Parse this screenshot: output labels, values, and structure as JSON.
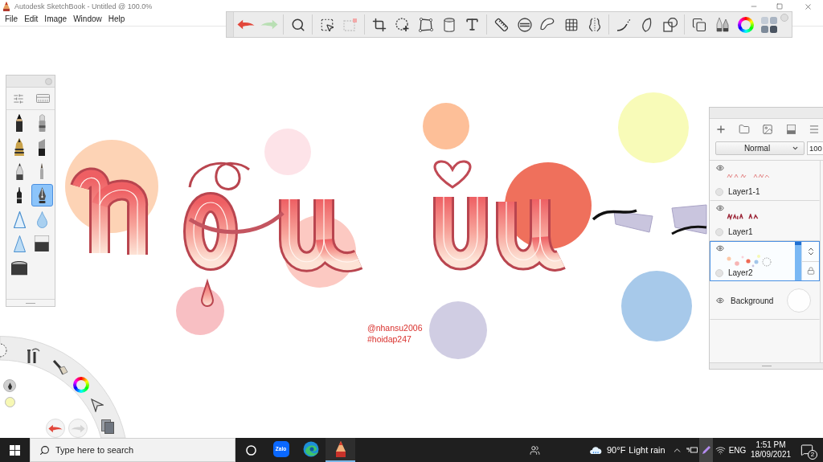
{
  "window": {
    "title": "Autodesk SketchBook - Untitled @ 100.0%"
  },
  "menu": [
    "File",
    "Edit",
    "Image",
    "Window",
    "Help"
  ],
  "toolbar": {
    "undo": {
      "disabled": false
    },
    "redo": {
      "disabled": true
    }
  },
  "brush_palette": {
    "brushes": [
      {
        "kind": "pencil",
        "selected": false
      },
      {
        "kind": "airbrush",
        "selected": false
      },
      {
        "kind": "inker",
        "selected": false
      },
      {
        "kind": "chisel",
        "selected": false
      },
      {
        "kind": "ballpoint",
        "selected": false
      },
      {
        "kind": "paintbrush",
        "selected": false
      },
      {
        "kind": "technical-pen",
        "selected": false
      },
      {
        "kind": "fountain-pen",
        "selected": true
      },
      {
        "kind": "smudge",
        "selected": false
      },
      {
        "kind": "drop",
        "selected": false
      },
      {
        "kind": "sharpen",
        "selected": false
      },
      {
        "kind": "hard-eraser",
        "selected": false
      },
      {
        "kind": "soft-eraser",
        "selected": false
      }
    ]
  },
  "layers_panel": {
    "blend_mode": "Normal",
    "opacity": "100",
    "layers": [
      {
        "kind": "lettering-light",
        "name": "Layer1-1",
        "visible": true,
        "selected": false
      },
      {
        "kind": "lettering-dark",
        "name": "Layer1",
        "visible": true,
        "selected": false
      },
      {
        "kind": "dots",
        "name": "Layer2",
        "visible": true,
        "selected": true,
        "level": 1
      },
      {
        "kind": "background",
        "name": "Background",
        "visible": true,
        "selected": false
      }
    ]
  },
  "canvas": {
    "signature": [
      "@nhansu2006",
      "#hoidap247"
    ]
  },
  "lagoon": {
    "undo": {
      "disabled": false
    },
    "redo": {
      "disabled": true
    }
  },
  "taskbar": {
    "search": {
      "placeholder": "Type here to search"
    },
    "apps": [
      {
        "kind": "zalo",
        "label": "Zalo",
        "active": false
      },
      {
        "kind": "edge",
        "active": false
      },
      {
        "kind": "sketchbook",
        "active": true
      }
    ],
    "weather": {
      "temperature": "90°F",
      "condition": "Light rain"
    },
    "tray": [
      {
        "kind": "chevron",
        "selected": false
      },
      {
        "kind": "power",
        "selected": false
      },
      {
        "kind": "pen",
        "selected": true
      },
      {
        "kind": "wifi",
        "selected": false
      }
    ],
    "language": "ENG",
    "time": "1:51 PM",
    "date": "18/09/2021",
    "notifications": "2"
  }
}
